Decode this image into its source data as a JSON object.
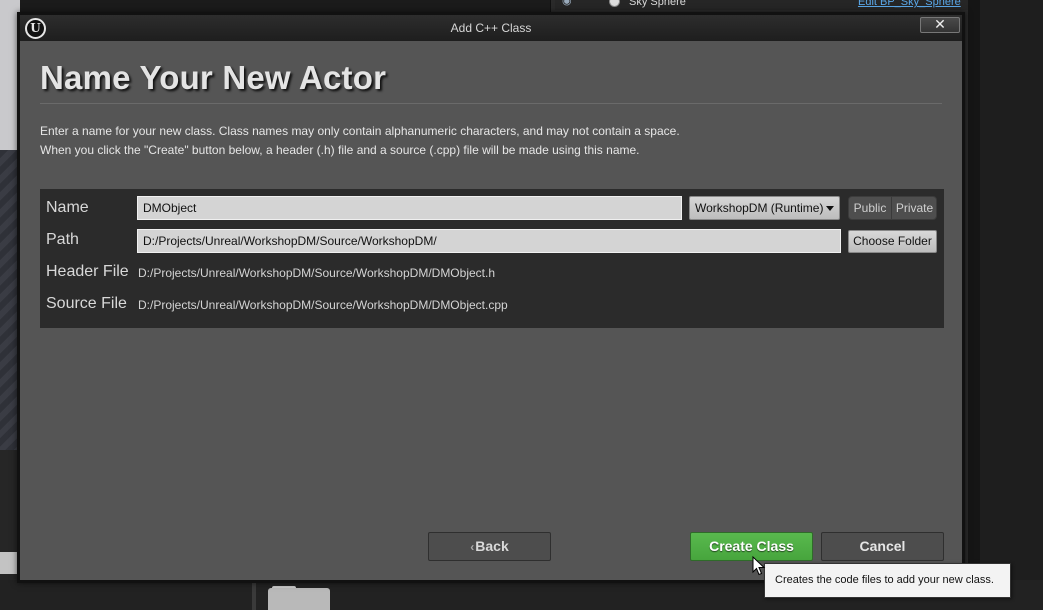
{
  "background": {
    "outliner_item": "Sky Sphere",
    "outliner_link": "Edit BP_Sky_Sphere"
  },
  "dialog": {
    "window_title": "Add C++ Class",
    "logo_glyph": "U",
    "close_glyph": "✕",
    "heading": "Name Your New Actor",
    "description_line1": "Enter a name for your new class. Class names may only contain alphanumeric characters, and may not contain a space.",
    "description_line2": "When you click the \"Create\" button below, a header (.h) file and a source (.cpp) file will be made using this name.",
    "form": {
      "name_label": "Name",
      "name_value": "DMObject",
      "module_value": "WorkshopDM (Runtime)",
      "public_label": "Public",
      "private_label": "Private",
      "path_label": "Path",
      "path_value": "D:/Projects/Unreal/WorkshopDM/Source/WorkshopDM/",
      "choose_folder_label": "Choose Folder",
      "header_label": "Header File",
      "header_value": "D:/Projects/Unreal/WorkshopDM/Source/WorkshopDM/DMObject.h",
      "source_label": "Source File",
      "source_value": "D:/Projects/Unreal/WorkshopDM/Source/WorkshopDM/DMObject.cpp"
    },
    "buttons": {
      "back_label": "Back",
      "back_glyph": "‹",
      "create_label": "Create Class",
      "cancel_label": "Cancel"
    },
    "tooltip": "Creates the code files to add your new class."
  },
  "colors": {
    "dialog_bg": "#555555",
    "panel_bg": "#2b2b2b",
    "create_green": "#4fb045",
    "link_blue": "#5aa7e8"
  }
}
